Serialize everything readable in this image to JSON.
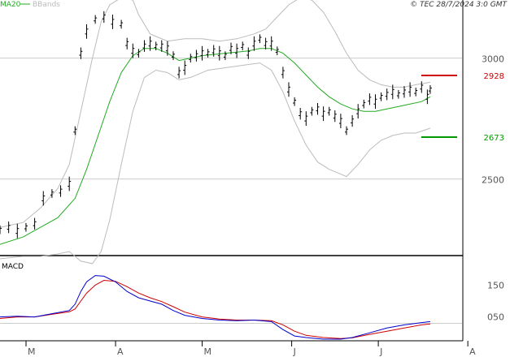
{
  "legend": {
    "ma20_label": "MA20",
    "bbands_label": "BBands",
    "ma20_color": "#22aa22",
    "bbands_color": "#bbbbbb"
  },
  "copyright": "© TEC 28/7/2024 3:0 GMT",
  "price_axis": {
    "ticks": [
      {
        "label": "3000",
        "value": 3000
      },
      {
        "label": "2500",
        "value": 2500
      }
    ],
    "markers": [
      {
        "label": "2928",
        "value": 2928,
        "color": "#cc0000"
      },
      {
        "label": "2673",
        "value": 2673,
        "color": "#009900"
      }
    ]
  },
  "macd": {
    "label": "MACD",
    "ticks": [
      {
        "label": "150",
        "value": 150
      },
      {
        "label": "050",
        "value": 50
      }
    ]
  },
  "x_axis": {
    "months": [
      {
        "label": "M",
        "day": 0
      },
      {
        "label": "A",
        "day": 31
      },
      {
        "label": "M",
        "day": 61
      },
      {
        "label": "J",
        "day": 92
      },
      {
        "label": "J",
        "day": 122
      },
      {
        "label": "A",
        "day": 153
      }
    ]
  },
  "chart_data": {
    "type": "line",
    "x_unit": "days from 1 March 2024",
    "price_ylim": [
      2200,
      3200
    ],
    "macd_ylim": [
      -20,
      230
    ],
    "price": [
      {
        "day": 0,
        "v": 2290
      },
      {
        "day": 3,
        "v": 2300
      },
      {
        "day": 6,
        "v": 2285
      },
      {
        "day": 9,
        "v": 2300
      },
      {
        "day": 12,
        "v": 2315
      },
      {
        "day": 15,
        "v": 2420
      },
      {
        "day": 18,
        "v": 2440
      },
      {
        "day": 21,
        "v": 2450
      },
      {
        "day": 24,
        "v": 2480
      },
      {
        "day": 26,
        "v": 2700
      },
      {
        "day": 28,
        "v": 3020
      },
      {
        "day": 30,
        "v": 3110
      },
      {
        "day": 33,
        "v": 3160
      },
      {
        "day": 36,
        "v": 3170
      },
      {
        "day": 39,
        "v": 3150
      },
      {
        "day": 42,
        "v": 3140
      },
      {
        "day": 44,
        "v": 3060
      },
      {
        "day": 46,
        "v": 3030
      },
      {
        "day": 48,
        "v": 3020
      },
      {
        "day": 50,
        "v": 3050
      },
      {
        "day": 52,
        "v": 3060
      },
      {
        "day": 54,
        "v": 3050
      },
      {
        "day": 56,
        "v": 3050
      },
      {
        "day": 58,
        "v": 3040
      },
      {
        "day": 60,
        "v": 3010
      },
      {
        "day": 62,
        "v": 2940
      },
      {
        "day": 64,
        "v": 2960
      },
      {
        "day": 66,
        "v": 3000
      },
      {
        "day": 68,
        "v": 3010
      },
      {
        "day": 70,
        "v": 3020
      },
      {
        "day": 72,
        "v": 3020
      },
      {
        "day": 74,
        "v": 3030
      },
      {
        "day": 76,
        "v": 3020
      },
      {
        "day": 78,
        "v": 3010
      },
      {
        "day": 80,
        "v": 3040
      },
      {
        "day": 82,
        "v": 3030
      },
      {
        "day": 84,
        "v": 3050
      },
      {
        "day": 86,
        "v": 3020
      },
      {
        "day": 88,
        "v": 3060
      },
      {
        "day": 90,
        "v": 3080
      },
      {
        "day": 92,
        "v": 3060
      },
      {
        "day": 94,
        "v": 3060
      },
      {
        "day": 96,
        "v": 3030
      },
      {
        "day": 98,
        "v": 2940
      },
      {
        "day": 100,
        "v": 2870
      },
      {
        "day": 102,
        "v": 2820
      },
      {
        "day": 104,
        "v": 2770
      },
      {
        "day": 106,
        "v": 2750
      },
      {
        "day": 108,
        "v": 2780
      },
      {
        "day": 110,
        "v": 2790
      },
      {
        "day": 112,
        "v": 2770
      },
      {
        "day": 114,
        "v": 2780
      },
      {
        "day": 116,
        "v": 2760
      },
      {
        "day": 118,
        "v": 2740
      },
      {
        "day": 120,
        "v": 2700
      },
      {
        "day": 122,
        "v": 2740
      },
      {
        "day": 124,
        "v": 2780
      },
      {
        "day": 126,
        "v": 2810
      },
      {
        "day": 128,
        "v": 2830
      },
      {
        "day": 130,
        "v": 2820
      },
      {
        "day": 132,
        "v": 2840
      },
      {
        "day": 134,
        "v": 2850
      },
      {
        "day": 136,
        "v": 2860
      },
      {
        "day": 138,
        "v": 2850
      },
      {
        "day": 140,
        "v": 2860
      },
      {
        "day": 142,
        "v": 2870
      },
      {
        "day": 144,
        "v": 2860
      },
      {
        "day": 146,
        "v": 2880
      },
      {
        "day": 148,
        "v": 2840
      },
      {
        "day": 149,
        "v": 2870
      }
    ],
    "ma20": [
      {
        "day": 0,
        "v": 2230
      },
      {
        "day": 8,
        "v": 2260
      },
      {
        "day": 14,
        "v": 2300
      },
      {
        "day": 20,
        "v": 2340
      },
      {
        "day": 26,
        "v": 2420
      },
      {
        "day": 30,
        "v": 2540
      },
      {
        "day": 34,
        "v": 2680
      },
      {
        "day": 38,
        "v": 2820
      },
      {
        "day": 42,
        "v": 2940
      },
      {
        "day": 46,
        "v": 3010
      },
      {
        "day": 50,
        "v": 3040
      },
      {
        "day": 54,
        "v": 3040
      },
      {
        "day": 58,
        "v": 3020
      },
      {
        "day": 62,
        "v": 2990
      },
      {
        "day": 66,
        "v": 3000
      },
      {
        "day": 70,
        "v": 3010
      },
      {
        "day": 74,
        "v": 3015
      },
      {
        "day": 78,
        "v": 3020
      },
      {
        "day": 82,
        "v": 3025
      },
      {
        "day": 86,
        "v": 3030
      },
      {
        "day": 90,
        "v": 3040
      },
      {
        "day": 94,
        "v": 3040
      },
      {
        "day": 98,
        "v": 3020
      },
      {
        "day": 102,
        "v": 2980
      },
      {
        "day": 106,
        "v": 2930
      },
      {
        "day": 110,
        "v": 2880
      },
      {
        "day": 114,
        "v": 2840
      },
      {
        "day": 118,
        "v": 2810
      },
      {
        "day": 122,
        "v": 2790
      },
      {
        "day": 126,
        "v": 2780
      },
      {
        "day": 130,
        "v": 2780
      },
      {
        "day": 134,
        "v": 2790
      },
      {
        "day": 138,
        "v": 2800
      },
      {
        "day": 142,
        "v": 2810
      },
      {
        "day": 146,
        "v": 2820
      },
      {
        "day": 149,
        "v": 2840
      }
    ],
    "bb_upper": [
      {
        "day": 0,
        "v": 2300
      },
      {
        "day": 8,
        "v": 2320
      },
      {
        "day": 14,
        "v": 2380
      },
      {
        "day": 20,
        "v": 2460
      },
      {
        "day": 24,
        "v": 2560
      },
      {
        "day": 28,
        "v": 2780
      },
      {
        "day": 32,
        "v": 3000
      },
      {
        "day": 35,
        "v": 3150
      },
      {
        "day": 38,
        "v": 3220
      },
      {
        "day": 42,
        "v": 3250
      },
      {
        "day": 46,
        "v": 3240
      },
      {
        "day": 48,
        "v": 3180
      },
      {
        "day": 52,
        "v": 3100
      },
      {
        "day": 58,
        "v": 3070
      },
      {
        "day": 64,
        "v": 3080
      },
      {
        "day": 70,
        "v": 3080
      },
      {
        "day": 76,
        "v": 3070
      },
      {
        "day": 82,
        "v": 3080
      },
      {
        "day": 88,
        "v": 3100
      },
      {
        "day": 92,
        "v": 3120
      },
      {
        "day": 96,
        "v": 3170
      },
      {
        "day": 100,
        "v": 3220
      },
      {
        "day": 104,
        "v": 3250
      },
      {
        "day": 108,
        "v": 3240
      },
      {
        "day": 112,
        "v": 3190
      },
      {
        "day": 116,
        "v": 3110
      },
      {
        "day": 120,
        "v": 3020
      },
      {
        "day": 124,
        "v": 2950
      },
      {
        "day": 128,
        "v": 2910
      },
      {
        "day": 132,
        "v": 2890
      },
      {
        "day": 136,
        "v": 2880
      },
      {
        "day": 140,
        "v": 2880
      },
      {
        "day": 144,
        "v": 2890
      },
      {
        "day": 149,
        "v": 2900
      }
    ],
    "bb_lower": [
      {
        "day": 0,
        "v": 2170
      },
      {
        "day": 8,
        "v": 2180
      },
      {
        "day": 14,
        "v": 2180
      },
      {
        "day": 20,
        "v": 2190
      },
      {
        "day": 24,
        "v": 2200
      },
      {
        "day": 28,
        "v": 2160
      },
      {
        "day": 32,
        "v": 2150
      },
      {
        "day": 35,
        "v": 2200
      },
      {
        "day": 38,
        "v": 2330
      },
      {
        "day": 42,
        "v": 2560
      },
      {
        "day": 46,
        "v": 2780
      },
      {
        "day": 50,
        "v": 2920
      },
      {
        "day": 54,
        "v": 2950
      },
      {
        "day": 58,
        "v": 2940
      },
      {
        "day": 62,
        "v": 2910
      },
      {
        "day": 66,
        "v": 2920
      },
      {
        "day": 72,
        "v": 2950
      },
      {
        "day": 78,
        "v": 2960
      },
      {
        "day": 84,
        "v": 2970
      },
      {
        "day": 90,
        "v": 2980
      },
      {
        "day": 94,
        "v": 2950
      },
      {
        "day": 98,
        "v": 2860
      },
      {
        "day": 102,
        "v": 2740
      },
      {
        "day": 106,
        "v": 2640
      },
      {
        "day": 110,
        "v": 2570
      },
      {
        "day": 114,
        "v": 2540
      },
      {
        "day": 118,
        "v": 2520
      },
      {
        "day": 120,
        "v": 2510
      },
      {
        "day": 124,
        "v": 2560
      },
      {
        "day": 128,
        "v": 2620
      },
      {
        "day": 132,
        "v": 2660
      },
      {
        "day": 136,
        "v": 2680
      },
      {
        "day": 140,
        "v": 2690
      },
      {
        "day": 144,
        "v": 2690
      },
      {
        "day": 149,
        "v": 2710
      }
    ],
    "macd_line": [
      {
        "day": 0,
        "v": 50
      },
      {
        "day": 6,
        "v": 52
      },
      {
        "day": 12,
        "v": 50
      },
      {
        "day": 18,
        "v": 60
      },
      {
        "day": 24,
        "v": 70
      },
      {
        "day": 26,
        "v": 90
      },
      {
        "day": 28,
        "v": 130
      },
      {
        "day": 30,
        "v": 160
      },
      {
        "day": 33,
        "v": 180
      },
      {
        "day": 36,
        "v": 178
      },
      {
        "day": 40,
        "v": 160
      },
      {
        "day": 44,
        "v": 130
      },
      {
        "day": 48,
        "v": 110
      },
      {
        "day": 52,
        "v": 100
      },
      {
        "day": 56,
        "v": 90
      },
      {
        "day": 60,
        "v": 70
      },
      {
        "day": 64,
        "v": 55
      },
      {
        "day": 70,
        "v": 45
      },
      {
        "day": 76,
        "v": 40
      },
      {
        "day": 82,
        "v": 38
      },
      {
        "day": 88,
        "v": 40
      },
      {
        "day": 94,
        "v": 35
      },
      {
        "day": 98,
        "v": 10
      },
      {
        "day": 102,
        "v": -10
      },
      {
        "day": 106,
        "v": -15
      },
      {
        "day": 112,
        "v": -20
      },
      {
        "day": 118,
        "v": -20
      },
      {
        "day": 122,
        "v": -15
      },
      {
        "day": 128,
        "v": 0
      },
      {
        "day": 134,
        "v": 15
      },
      {
        "day": 140,
        "v": 25
      },
      {
        "day": 146,
        "v": 32
      },
      {
        "day": 149,
        "v": 35
      }
    ],
    "signal_line": [
      {
        "day": 0,
        "v": 45
      },
      {
        "day": 6,
        "v": 50
      },
      {
        "day": 12,
        "v": 50
      },
      {
        "day": 18,
        "v": 58
      },
      {
        "day": 24,
        "v": 66
      },
      {
        "day": 26,
        "v": 75
      },
      {
        "day": 28,
        "v": 100
      },
      {
        "day": 30,
        "v": 125
      },
      {
        "day": 33,
        "v": 150
      },
      {
        "day": 36,
        "v": 165
      },
      {
        "day": 40,
        "v": 162
      },
      {
        "day": 44,
        "v": 145
      },
      {
        "day": 48,
        "v": 125
      },
      {
        "day": 52,
        "v": 110
      },
      {
        "day": 56,
        "v": 98
      },
      {
        "day": 60,
        "v": 82
      },
      {
        "day": 64,
        "v": 65
      },
      {
        "day": 70,
        "v": 50
      },
      {
        "day": 76,
        "v": 43
      },
      {
        "day": 82,
        "v": 40
      },
      {
        "day": 88,
        "v": 40
      },
      {
        "day": 94,
        "v": 38
      },
      {
        "day": 98,
        "v": 25
      },
      {
        "day": 102,
        "v": 5
      },
      {
        "day": 106,
        "v": -8
      },
      {
        "day": 112,
        "v": -15
      },
      {
        "day": 118,
        "v": -18
      },
      {
        "day": 122,
        "v": -16
      },
      {
        "day": 128,
        "v": -5
      },
      {
        "day": 134,
        "v": 5
      },
      {
        "day": 140,
        "v": 15
      },
      {
        "day": 146,
        "v": 25
      },
      {
        "day": 149,
        "v": 28
      }
    ],
    "macd_color": "#0000cc",
    "signal_color": "#cc0000",
    "price_color": "#000000",
    "ma20_color": "#22aa22",
    "bbands_color": "#bbbbbb"
  }
}
